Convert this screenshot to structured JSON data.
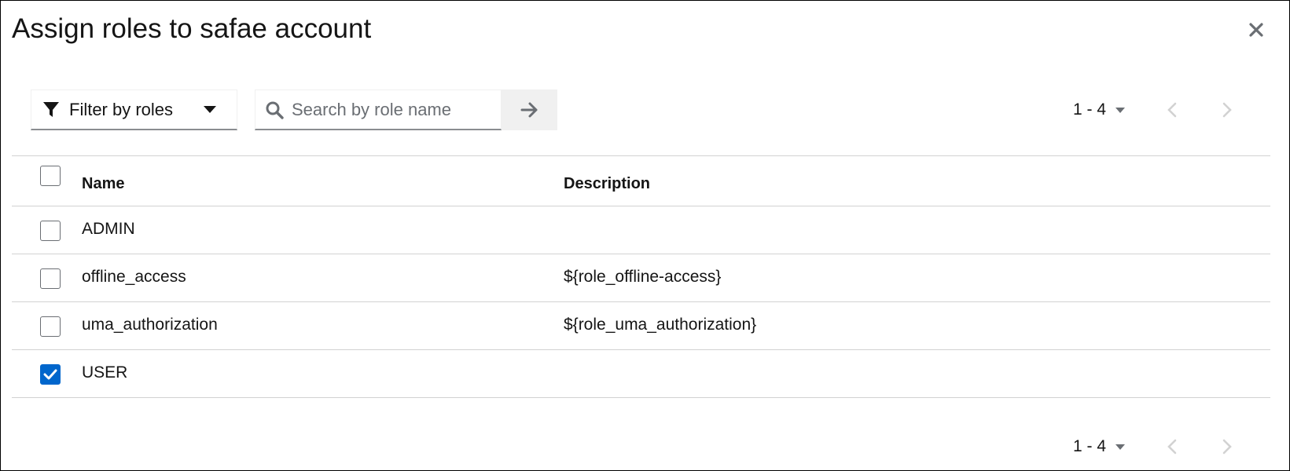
{
  "modal": {
    "title": "Assign roles to safae account",
    "close_icon": "close-icon"
  },
  "toolbar": {
    "filter_label": "Filter by roles",
    "filter_icon": "filter-icon",
    "search_placeholder": "Search by role name",
    "search_value": "",
    "search_icon": "search-icon",
    "search_go_icon": "arrow-right-icon"
  },
  "pagination_top": {
    "range": "1 - 4",
    "prev_icon": "chevron-left-icon",
    "next_icon": "chevron-right-icon"
  },
  "pagination_bottom": {
    "range": "1 - 4",
    "prev_icon": "chevron-left-icon",
    "next_icon": "chevron-right-icon"
  },
  "table": {
    "columns": [
      "Name",
      "Description"
    ],
    "rows": [
      {
        "name": "ADMIN",
        "description": "",
        "checked": false
      },
      {
        "name": "offline_access",
        "description": "${role_offline-access}",
        "checked": false
      },
      {
        "name": "uma_authorization",
        "description": "${role_uma_authorization}",
        "checked": false
      },
      {
        "name": "USER",
        "description": "",
        "checked": true
      }
    ]
  },
  "colors": {
    "accent": "#0066cc",
    "border": "#d2d2d2",
    "disabled_icon": "#d2d2d2"
  }
}
